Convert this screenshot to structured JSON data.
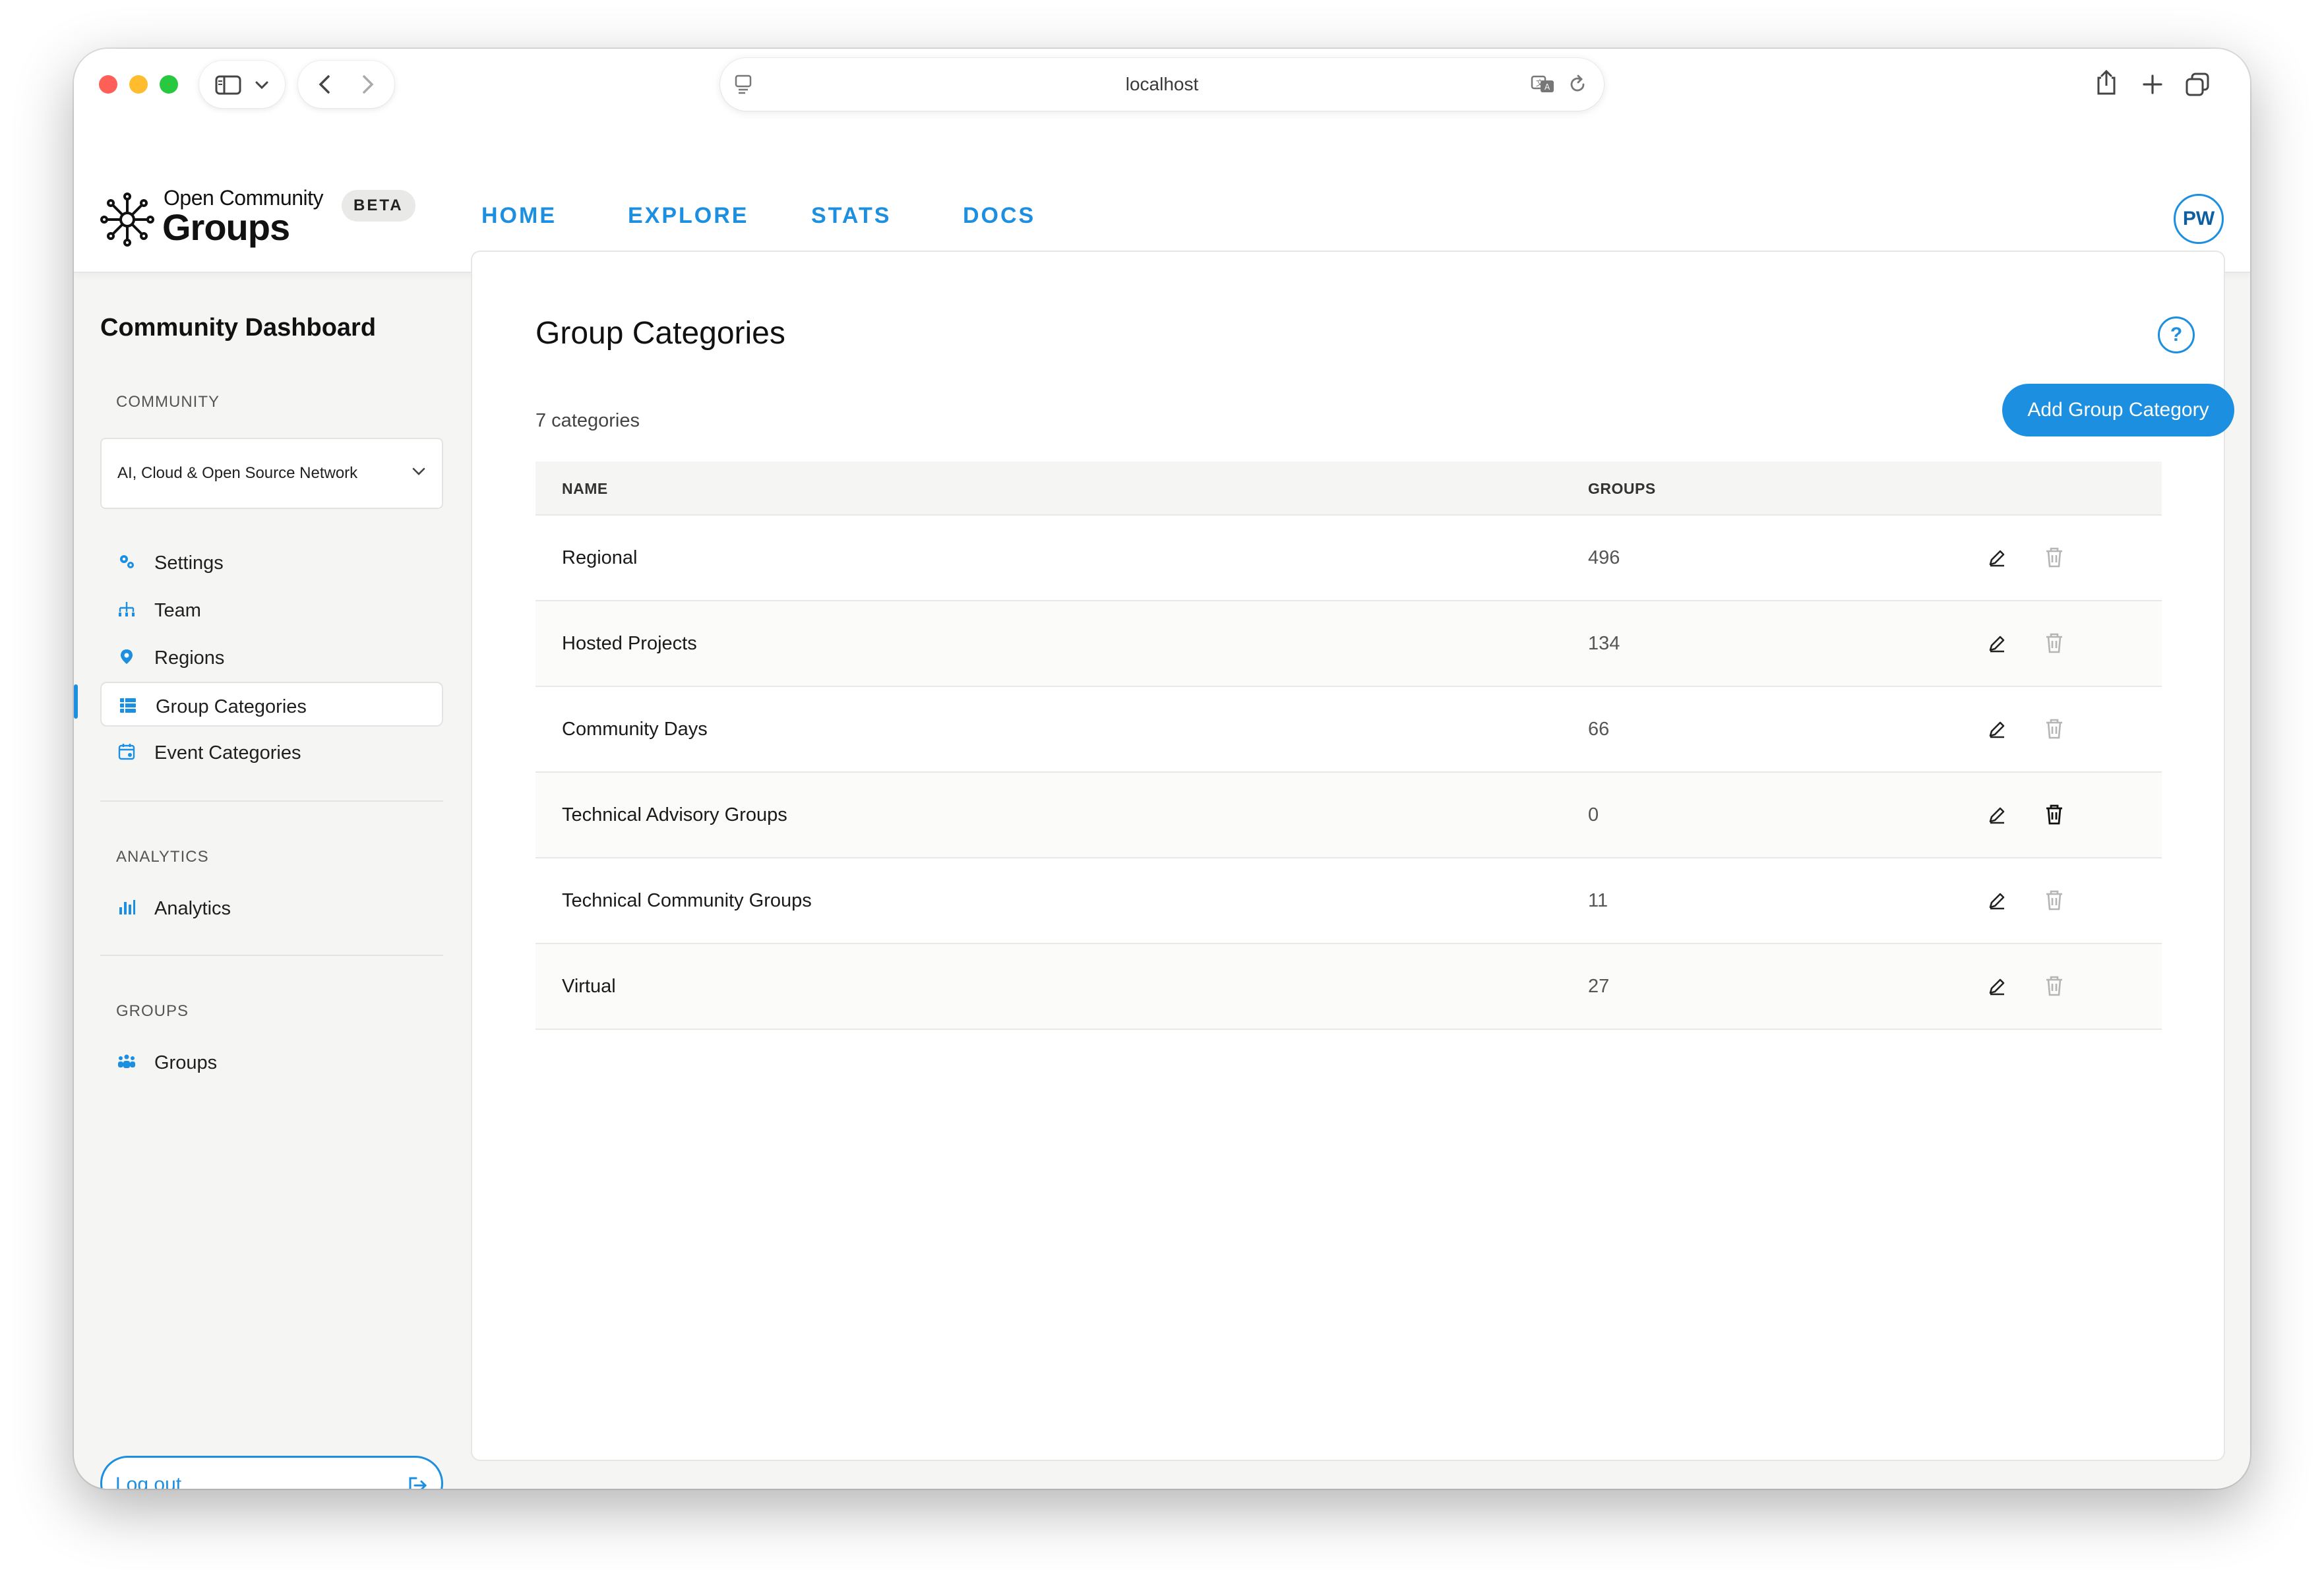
{
  "browser": {
    "url": "localhost"
  },
  "header": {
    "logo_top": "Open Community",
    "logo_main": "Groups",
    "beta": "BETA",
    "nav": [
      "HOME",
      "EXPLORE",
      "STATS",
      "DOCS"
    ],
    "avatar": "PW"
  },
  "sidebar": {
    "title": "Community Dashboard",
    "section_community": "COMMUNITY",
    "community_select": "AI, Cloud & Open Source Network",
    "items": [
      {
        "label": "Settings",
        "icon": "gears-icon"
      },
      {
        "label": "Team",
        "icon": "org-chart-icon"
      },
      {
        "label": "Regions",
        "icon": "map-pin-icon"
      },
      {
        "label": "Group Categories",
        "icon": "table-list-icon",
        "active": true
      },
      {
        "label": "Event Categories",
        "icon": "calendar-icon"
      }
    ],
    "section_analytics": "ANALYTICS",
    "analytics_item": "Analytics",
    "section_groups": "GROUPS",
    "groups_item": "Groups",
    "logout": "Log out"
  },
  "main": {
    "title": "Group Categories",
    "count": "7 categories",
    "add_button": "Add Group Category",
    "help": "?",
    "columns": {
      "name": "NAME",
      "groups": "GROUPS"
    },
    "rows": [
      {
        "name": "Regional",
        "groups": "496",
        "delete_enabled": false
      },
      {
        "name": "Hosted Projects",
        "groups": "134",
        "delete_enabled": false
      },
      {
        "name": "Community Days",
        "groups": "66",
        "delete_enabled": false
      },
      {
        "name": "Technical Advisory Groups",
        "groups": "0",
        "delete_enabled": true
      },
      {
        "name": "Technical Community Groups",
        "groups": "11",
        "delete_enabled": false
      },
      {
        "name": "Virtual",
        "groups": "27",
        "delete_enabled": false
      }
    ]
  },
  "colors": {
    "accent": "#1c8fe0",
    "background": "#f5f5f4"
  }
}
